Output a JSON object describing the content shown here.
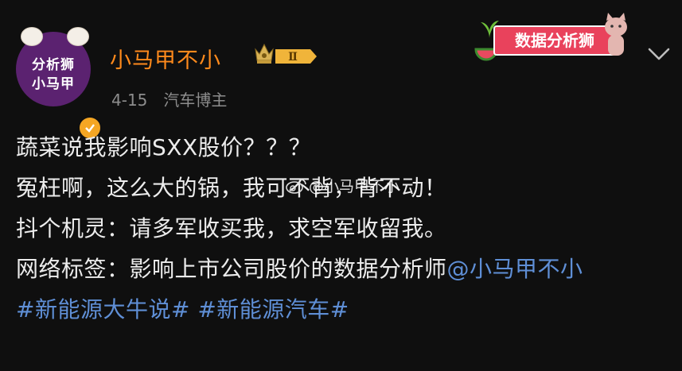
{
  "user": {
    "name": "小马甲不小",
    "avatar_line1": "分析狮",
    "avatar_line2": "小马甲",
    "level": "Ⅱ",
    "date": "4-15",
    "source": "汽车博主"
  },
  "promo": {
    "label": "数据分析狮"
  },
  "post": {
    "line1": "蔬菜说我影响SXX股价？？？",
    "line2": "冤枉啊，这么大的锅，我可不背，背不动！",
    "line3": "抖个机灵：请多军收买我，求空军收留我。",
    "line4_text": "网络标签：影响上市公司股价的数据分析师",
    "mention": "@小马甲不小",
    "tag1": "#新能源大牛说#",
    "tag2": "#新能源汽车#"
  },
  "watermark": {
    "text": "@小马甲不小"
  },
  "colors": {
    "username": "#ff8a1c",
    "link": "#5f8fd6",
    "background": "#0f0f0f",
    "avatar_bg": "#5b2270",
    "promo_bg": "#e9425c"
  }
}
